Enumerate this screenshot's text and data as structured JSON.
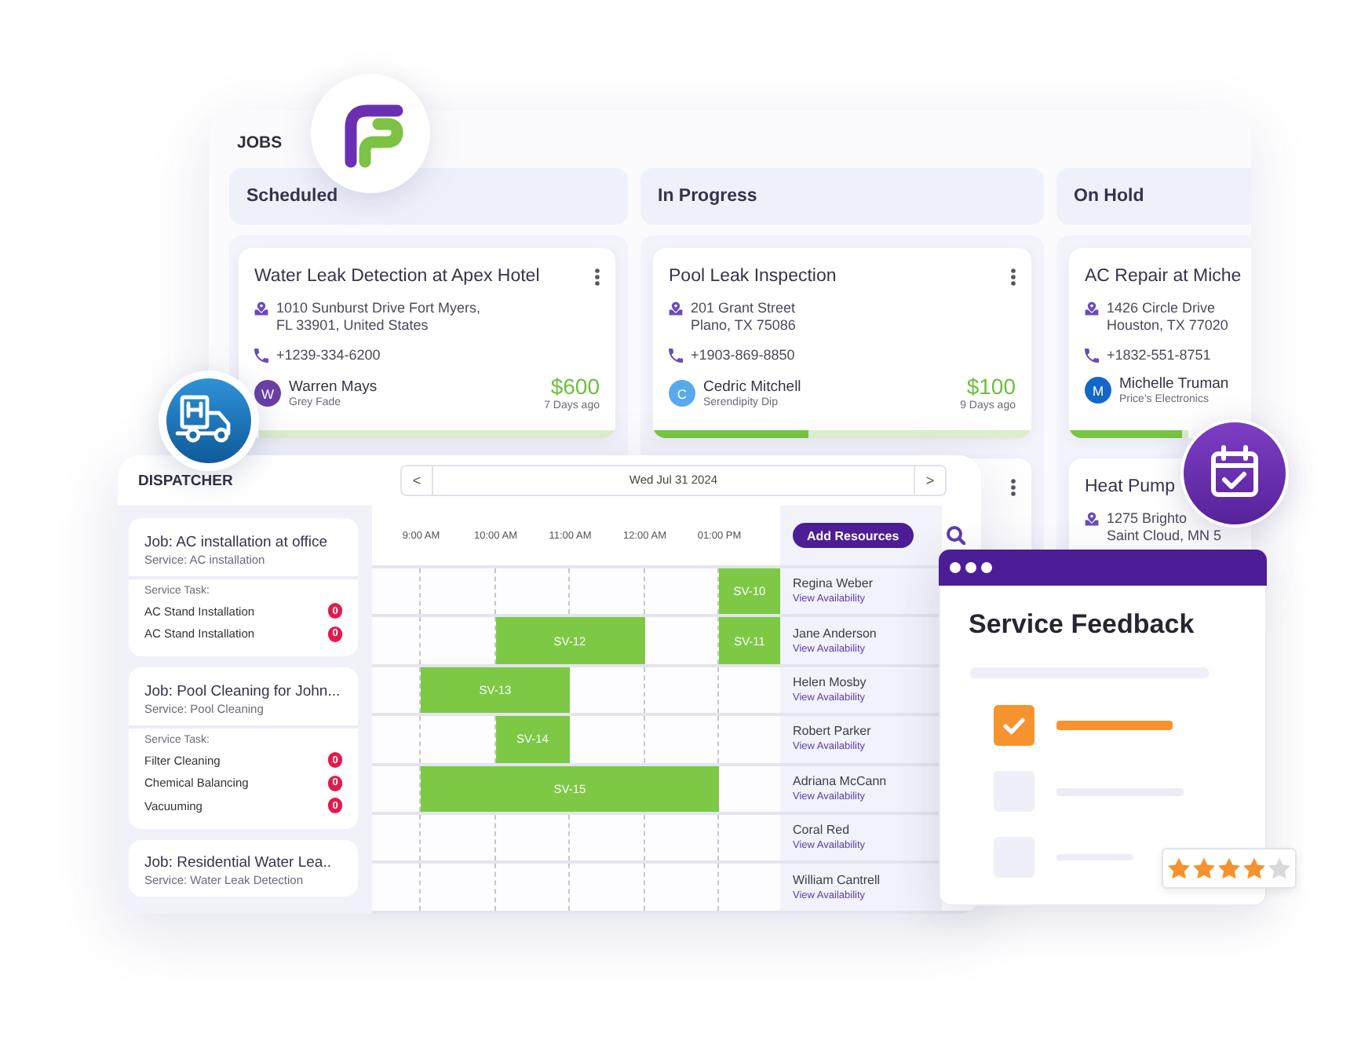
{
  "jobs_board": {
    "title": "JOBS",
    "columns": [
      {
        "title": "Scheduled",
        "cards": [
          {
            "title": "Water Leak Detection at Apex Hotel",
            "menu": true,
            "address_lines": [
              "1010 Sunburst Drive Fort Myers,",
              "FL 33901, United States"
            ],
            "phone": "+1239-334-6200",
            "contact": {
              "initial": "W",
              "color": "#6a3fa6",
              "name": "Warren Mays",
              "company": "Grey Fade"
            },
            "price": "$600",
            "age": "7 Days ago",
            "level": 0
          }
        ]
      },
      {
        "title": "In Progress",
        "cards": [
          {
            "title": "Pool Leak Inspection",
            "menu": true,
            "address_lines": [
              "201 Grant Street",
              "Plano, TX 75086"
            ],
            "phone": "+1903-869-8850",
            "contact": {
              "initial": "C",
              "color": "#58a9ee",
              "name": "Cedric Mitchell",
              "company": "Serendipity Dip"
            },
            "price": "$100",
            "age": "9 Days ago",
            "level": 0.41
          },
          {
            "menu": true
          }
        ]
      },
      {
        "title": "On Hold",
        "cards": [
          {
            "title": "AC Repair at Miche",
            "menu": false,
            "address_lines": [
              "1426 Circle Drive",
              "Houston, TX 77020"
            ],
            "phone": "+1832-551-8751",
            "contact": {
              "initial": "M",
              "color": "#1467c9",
              "name": "Michelle Truman",
              "company": "Price's Electronics"
            },
            "level": 0.95
          },
          {
            "title": "Heat Pump",
            "menu": false,
            "address_lines": [
              "1275 Brighto",
              "Saint Cloud, MN 5"
            ]
          }
        ]
      }
    ]
  },
  "dispatcher": {
    "title": "DISPATCHER",
    "date_nav": {
      "prev": "<",
      "date": "Wed Jul 31 2024",
      "next": ">"
    },
    "jobs": [
      {
        "title": "Job: AC installation at office",
        "service": "Service: AC installation",
        "task_heading": "Service Task:",
        "tasks": [
          {
            "name": "AC Stand Installation",
            "count": "0"
          },
          {
            "name": "AC Stand Installation",
            "count": "0"
          }
        ]
      },
      {
        "title": "Job: Pool Cleaning for John...",
        "service": "Service: Pool Cleaning",
        "task_heading": "Service Task:",
        "tasks": [
          {
            "name": "Filter Cleaning",
            "count": "0"
          },
          {
            "name": "Chemical Balancing",
            "count": "0"
          },
          {
            "name": "Vacuuming",
            "count": "0"
          }
        ]
      },
      {
        "title": "Job: Residential Water Lea..",
        "service": "Service: Water Leak Detection"
      }
    ],
    "times": [
      "9:00 AM",
      "10:00 AM",
      "11:00 AM",
      "12:00 AM",
      "01:00 PM"
    ],
    "add_button": "Add Resources",
    "resources": [
      {
        "name": "Regina Weber",
        "link": "View Availability",
        "slots": [
          {
            "booked": false
          },
          {
            "booked": false
          },
          {
            "booked": false
          },
          {
            "booked": false
          },
          {
            "booked": false
          },
          {
            "booked": true,
            "label": "SV-10"
          }
        ]
      },
      {
        "name": "Jane Anderson",
        "link": "View Availability",
        "slots": [
          {
            "booked": false
          },
          {
            "booked": false
          },
          {
            "booked": true,
            "label": "SV-12"
          },
          {
            "booked": true
          },
          {
            "booked": false
          },
          {
            "booked": true,
            "label": "SV-11"
          }
        ]
      },
      {
        "name": "Helen Mosby",
        "link": "View Availability",
        "slots": [
          {
            "booked": false
          },
          {
            "booked": true,
            "label": "SV-13"
          },
          {
            "booked": true
          },
          {
            "booked": false
          },
          {
            "booked": false
          },
          {
            "booked": false
          }
        ]
      },
      {
        "name": "Robert Parker",
        "link": "View Availability",
        "slots": [
          {
            "booked": false
          },
          {
            "booked": false
          },
          {
            "booked": true,
            "label": "SV-14"
          },
          {
            "booked": false
          },
          {
            "booked": false
          },
          {
            "booked": false
          }
        ]
      },
      {
        "name": "Adriana McCann",
        "link": "View Availability",
        "slots": [
          {
            "booked": false
          },
          {
            "booked": true,
            "label": "SV-15"
          },
          {
            "booked": true
          },
          {
            "booked": true
          },
          {
            "booked": true
          },
          {
            "booked": false
          }
        ]
      },
      {
        "name": "Coral Red",
        "link": "View Availability",
        "slots": [
          {
            "booked": false
          },
          {
            "booked": false
          },
          {
            "booked": false
          },
          {
            "booked": false
          },
          {
            "booked": false
          },
          {
            "booked": false
          }
        ]
      },
      {
        "name": "William Cantrell",
        "link": "View Availability",
        "slots": [
          {
            "booked": false
          },
          {
            "booked": false
          },
          {
            "booked": false
          },
          {
            "booked": false
          },
          {
            "booked": false
          },
          {
            "booked": false
          }
        ]
      }
    ]
  },
  "feedback": {
    "title": "Service Feedback",
    "items": [
      {
        "checked": true
      },
      {
        "checked": false
      },
      {
        "checked": false
      }
    ],
    "stars": 4
  }
}
